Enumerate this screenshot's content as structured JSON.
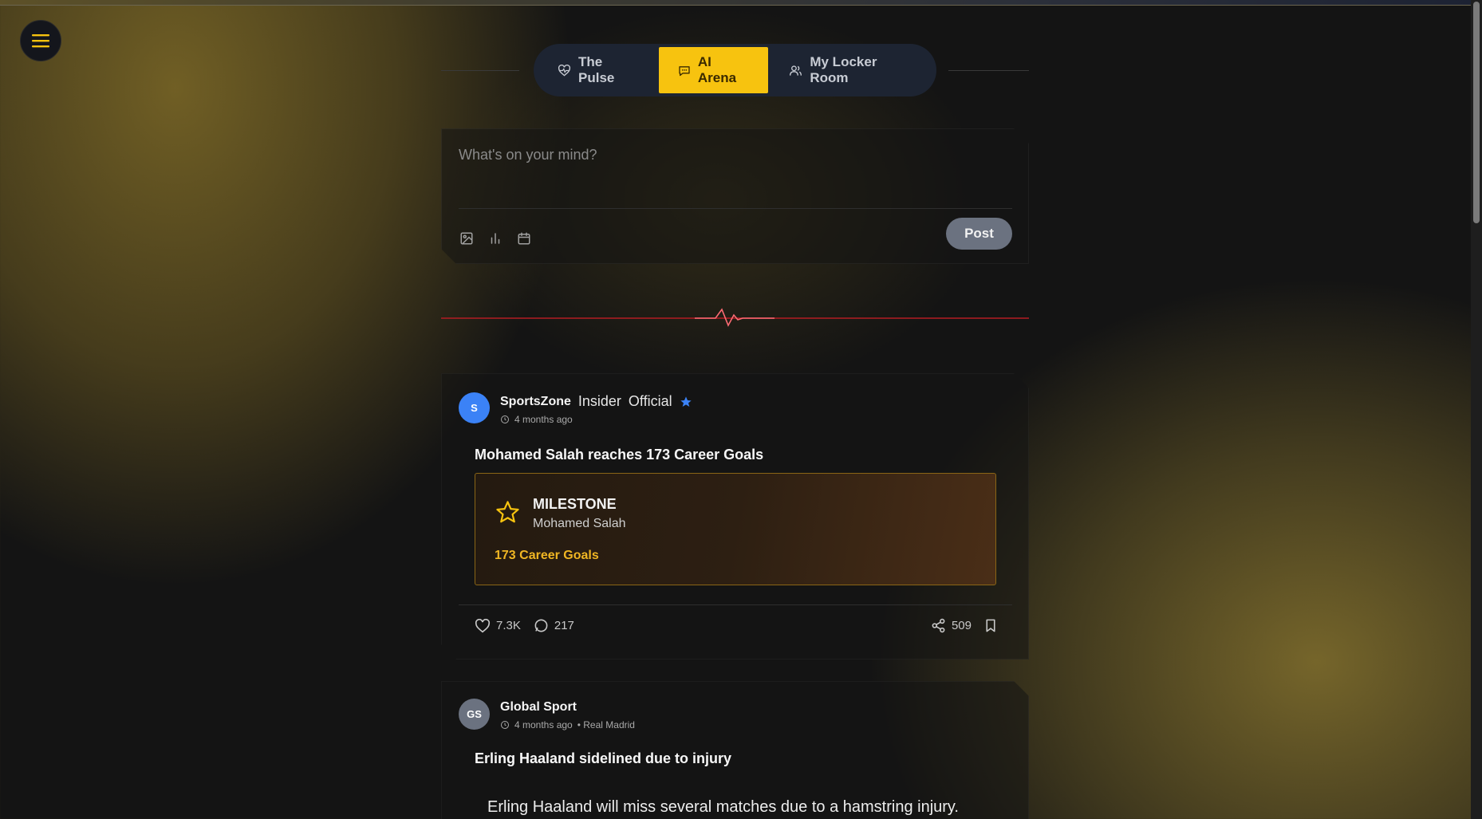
{
  "nav": {
    "menu_icon": "hamburger-menu-icon",
    "tabs": [
      {
        "label": "The Pulse",
        "icon": "heart-pulse-icon",
        "active": false
      },
      {
        "label": "AI Arena",
        "icon": "chat-bubble-icon",
        "active": true
      },
      {
        "label": "My Locker Room",
        "icon": "users-icon",
        "active": false
      }
    ]
  },
  "composer": {
    "placeholder": "What's on your mind?",
    "tools": [
      "image-icon",
      "bar-chart-icon",
      "calendar-icon"
    ],
    "post_label": "Post"
  },
  "feed": {
    "posts": [
      {
        "avatar_initials": "S",
        "avatar_color": "#3b82f6",
        "author": "SportsZone",
        "tag1": "Insider",
        "tag2": "Official",
        "verified": true,
        "time": "4 months ago",
        "title": "Mohamed Salah reaches 173 Career Goals",
        "milestone": {
          "label": "MILESTONE",
          "player": "Mohamed Salah",
          "stat": "173 Career Goals"
        },
        "likes": "7.3K",
        "comments": "217",
        "shares": "509"
      },
      {
        "avatar_initials": "GS",
        "avatar_color": "#6b7280",
        "author": "Global Sport",
        "time": "4 months ago",
        "team": "• Real Madrid",
        "title": "Erling Haaland sidelined due to injury",
        "body": "Erling Haaland will miss several matches due to a hamstring injury."
      }
    ]
  },
  "colors": {
    "accent": "#f7c30f",
    "pulse_line": "#d81f26",
    "milestone_stat": "#f0b623",
    "verified": "#3b82f6"
  }
}
